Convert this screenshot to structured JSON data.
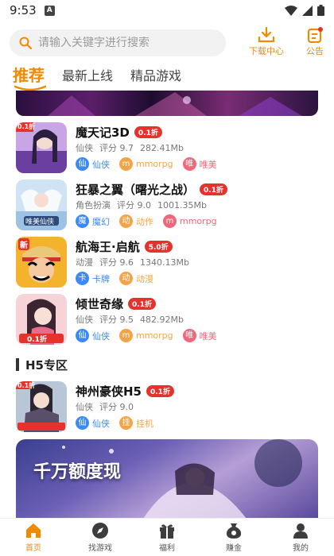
{
  "status": {
    "time": "9:53",
    "notification_glyph": "A"
  },
  "search": {
    "placeholder": "请输入关键字进行搜索",
    "value": ""
  },
  "top_actions": {
    "download": "下载中心",
    "notice": "公告"
  },
  "tabs": [
    {
      "label": "推荐",
      "active": true
    },
    {
      "label": "最新上线",
      "active": false
    },
    {
      "label": "精品游戏",
      "active": false
    }
  ],
  "games": [
    {
      "name": "魔天记3D",
      "discount": "0.1折",
      "category": "仙侠",
      "rating": "评分 9.7",
      "size": "282.41Mb",
      "tags": [
        {
          "glyph": "仙",
          "label": "仙侠",
          "color": "#3c8af5"
        },
        {
          "glyph": "m",
          "label": "mmorpg",
          "color": "#f4a448"
        },
        {
          "glyph": "唯",
          "label": "唯美",
          "color": "#f0677a"
        }
      ]
    },
    {
      "name": "狂暴之翼（曙光之战）",
      "discount": "0.1折",
      "category": "角色扮演",
      "rating": "评分 9.0",
      "size": "1001.35Mb",
      "tags": [
        {
          "glyph": "魔",
          "label": "魔幻",
          "color": "#3c8af5"
        },
        {
          "glyph": "动",
          "label": "动作",
          "color": "#f4a448"
        },
        {
          "glyph": "m",
          "label": "mmorpg",
          "color": "#f0677a"
        }
      ]
    },
    {
      "name": "航海王·启航",
      "discount": "5.0折",
      "category": "动漫",
      "rating": "评分 9.6",
      "size": "1340.13Mb",
      "tags": [
        {
          "glyph": "卡",
          "label": "卡牌",
          "color": "#3c8af5"
        },
        {
          "glyph": "动",
          "label": "动漫",
          "color": "#f4a448"
        }
      ]
    },
    {
      "name": "倾世奇缘",
      "discount": "0.1折",
      "category": "仙侠",
      "rating": "评分 9.5",
      "size": "482.92Mb",
      "tags": [
        {
          "glyph": "仙",
          "label": "仙侠",
          "color": "#3c8af5"
        },
        {
          "glyph": "m",
          "label": "mmorpg",
          "color": "#f4a448"
        },
        {
          "glyph": "唯",
          "label": "唯美",
          "color": "#f0677a"
        }
      ]
    }
  ],
  "h5_section": {
    "title": "H5专区",
    "games": [
      {
        "name": "神州豪侠H5",
        "discount": "0.1折",
        "category": "仙侠",
        "rating": "评分 9.0",
        "size": "",
        "tags": [
          {
            "glyph": "仙",
            "label": "仙侠",
            "color": "#3c8af5"
          },
          {
            "glyph": "挂",
            "label": "挂机",
            "color": "#f4a448"
          }
        ]
      }
    ]
  },
  "icon_badges": {
    "game0": "0.1折",
    "game1": "唯美仙侠",
    "game2": "新",
    "game3": "0.1折",
    "h5_0": "0.1折"
  },
  "banner_text": "千万额度现",
  "bottom_nav": [
    {
      "label": "首页",
      "icon": "home-icon",
      "active": true
    },
    {
      "label": "找游戏",
      "icon": "compass-icon",
      "active": false
    },
    {
      "label": "福利",
      "icon": "gift-icon",
      "active": false
    },
    {
      "label": "赚金",
      "icon": "coin-bag-icon",
      "active": false
    },
    {
      "label": "我的",
      "icon": "user-icon",
      "active": false
    }
  ],
  "colors": {
    "accent": "#f08a00",
    "discount_red": "#e5322d"
  }
}
